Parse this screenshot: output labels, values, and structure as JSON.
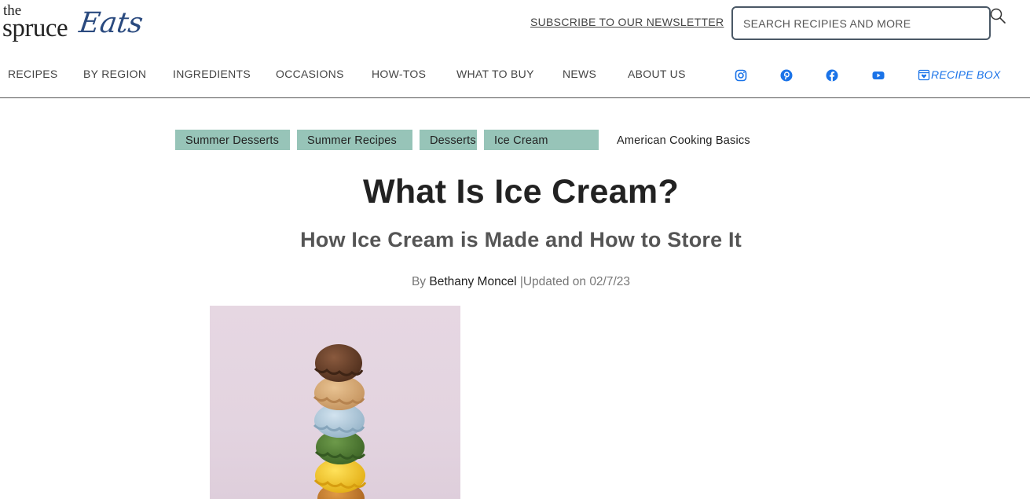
{
  "brand": {
    "line1": "the",
    "line2": "spruce",
    "script": "Eats",
    "script_color": "#2a4a7f"
  },
  "header": {
    "newsletter_label": "SUBSCRIBE TO OUR NEWSLETTER",
    "search_placeholder": "SEARCH RECIPIES AND MORE",
    "search_icon": "search-icon"
  },
  "nav": {
    "items": [
      {
        "label": "RECIPES"
      },
      {
        "label": "BY REGION"
      },
      {
        "label": "INGREDIENTS"
      },
      {
        "label": "OCCASIONS"
      },
      {
        "label": "HOW-TOS"
      },
      {
        "label": "WHAT TO BUY"
      },
      {
        "label": "NEWS"
      },
      {
        "label": "ABOUT US"
      }
    ],
    "social_icons": [
      "instagram-icon",
      "pinterest-icon",
      "facebook-icon",
      "youtube-icon"
    ],
    "recipe_box_label": "RECIPE BOX",
    "accent_color": "#1a73e8"
  },
  "tags": {
    "items": [
      {
        "label": "Summer Desserts"
      },
      {
        "label": "Summer Recipes"
      },
      {
        "label": "Desserts"
      },
      {
        "label": "Ice Cream"
      }
    ],
    "plain": "American Cooking Basics",
    "tag_color": "#97c4b8"
  },
  "article": {
    "title": "What Is Ice Cream?",
    "subtitle": "How Ice Cream is Made and How to Store It",
    "by_prefix": "By",
    "author": "Bethany Moncel",
    "separator": "|",
    "updated": "Updated on 02/7/23"
  }
}
